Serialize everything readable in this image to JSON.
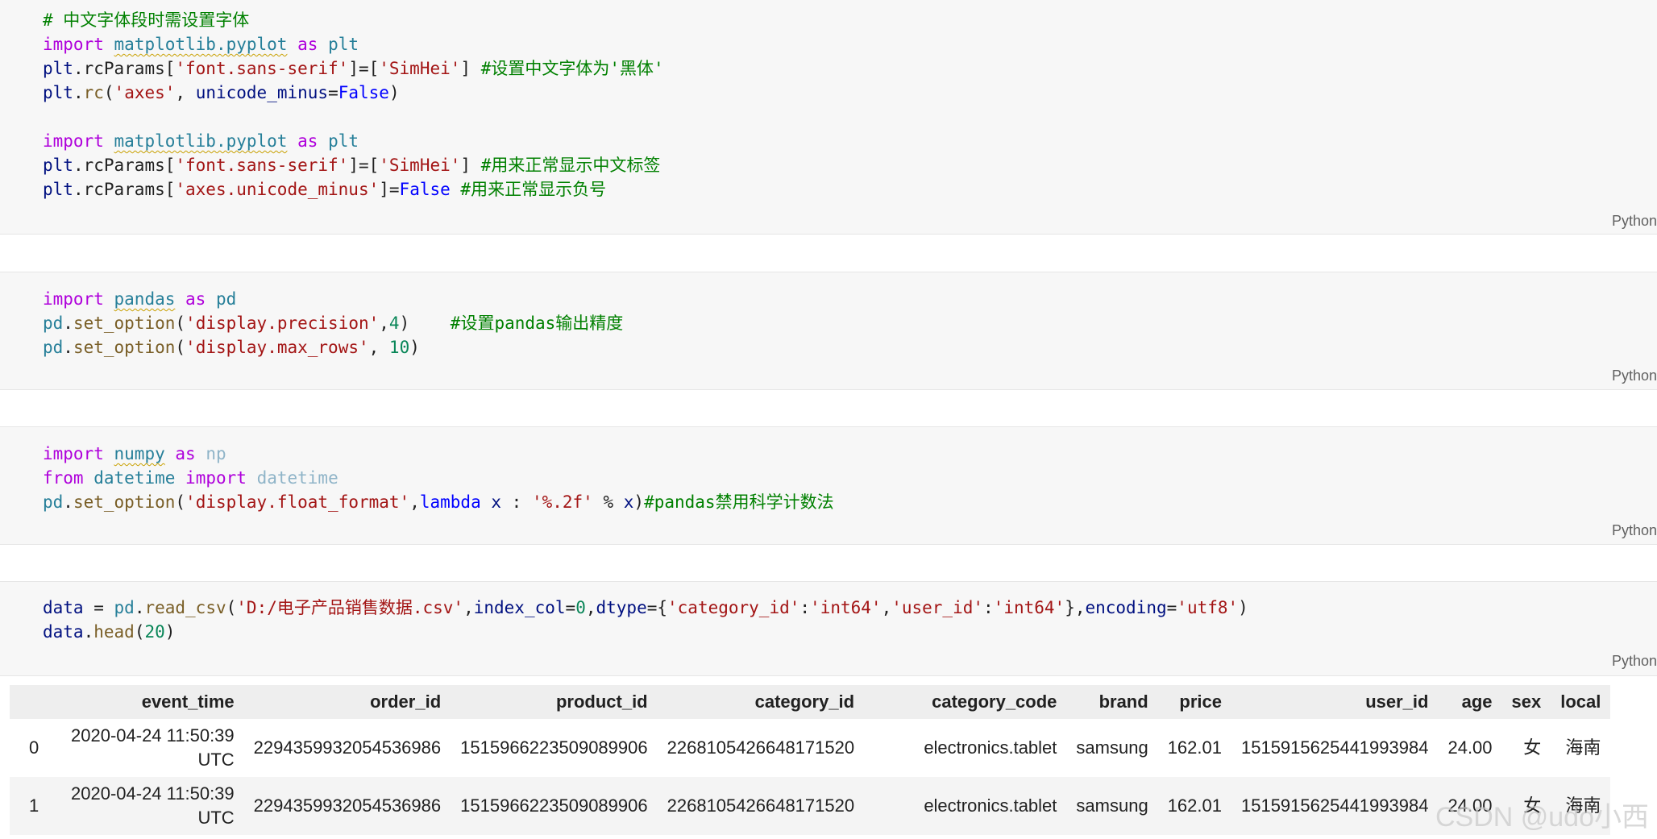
{
  "cells": [
    {
      "language": "Python",
      "code": {
        "l1": "# 中文字体段时需设置字体",
        "l2_kw": "import",
        "l2_mod": "matplotlib.pyplot",
        "l2_as": "as",
        "l2_alias": "plt",
        "l3_a": "plt",
        "l3_b": ".rcParams[",
        "l3_str1": "'font.sans-serif'",
        "l3_c": "]=[",
        "l3_str2": "'SimHei'",
        "l3_d": "] ",
        "l3_cmt": "#设置中文字体为'黑体'",
        "l4_a": "plt",
        "l4_b": ".",
        "l4_fn": "rc",
        "l4_c": "(",
        "l4_str": "'axes'",
        "l4_d": ", ",
        "l4_kwarg": "unicode_minus",
        "l4_e": "=",
        "l4_const": "False",
        "l4_f": ")",
        "l6_kw": "import",
        "l6_mod": "matplotlib.pyplot",
        "l6_as": "as",
        "l6_alias": "plt",
        "l7_a": "plt",
        "l7_b": ".rcParams[",
        "l7_str1": "'font.sans-serif'",
        "l7_c": "]=[",
        "l7_str2": "'SimHei'",
        "l7_d": "] ",
        "l7_cmt": "#用来正常显示中文标签",
        "l8_a": "plt",
        "l8_b": ".rcParams[",
        "l8_str": "'axes.unicode_minus'",
        "l8_c": "]=",
        "l8_const": "False",
        "l8_d": " ",
        "l8_cmt": "#用来正常显示负号"
      }
    },
    {
      "language": "Python",
      "code": {
        "l1_kw": "import",
        "l1_mod": "pandas",
        "l1_as": "as",
        "l1_alias": "pd",
        "l2_a": "pd",
        "l2_b": ".",
        "l2_fn": "set_option",
        "l2_c": "(",
        "l2_str": "'display.precision'",
        "l2_d": ",",
        "l2_num": "4",
        "l2_e": ")    ",
        "l2_cmt": "#设置pandas输出精度",
        "l3_a": "pd",
        "l3_b": ".",
        "l3_fn": "set_option",
        "l3_c": "(",
        "l3_str": "'display.max_rows'",
        "l3_d": ", ",
        "l3_num": "10",
        "l3_e": ")"
      }
    },
    {
      "language": "Python",
      "code": {
        "l1_kw": "import",
        "l1_mod": "numpy",
        "l1_as": "as",
        "l1_alias": "np",
        "l2_from": "from",
        "l2_mod": "datetime",
        "l2_import": "import",
        "l2_name": "datetime",
        "l3_a": "pd",
        "l3_b": ".",
        "l3_fn": "set_option",
        "l3_c": "(",
        "l3_str": "'display.float_format'",
        "l3_d": ",",
        "l3_lambda": "lambda",
        "l3_e": " ",
        "l3_x1": "x",
        "l3_f": " : ",
        "l3_str2": "'%.2f'",
        "l3_g": " % ",
        "l3_x2": "x",
        "l3_h": ")",
        "l3_cmt": "#pandas禁用科学计数法"
      }
    },
    {
      "language": "Python",
      "code": {
        "l1_a": "data",
        "l1_b": " = ",
        "l1_pd": "pd",
        "l1_c": ".",
        "l1_fn": "read_csv",
        "l1_d": "(",
        "l1_str1": "'D:/电子产品销售数据.csv'",
        "l1_e": ",",
        "l1_k1": "index_col",
        "l1_f": "=",
        "l1_num": "0",
        "l1_g": ",",
        "l1_k2": "dtype",
        "l1_h": "={",
        "l1_s2": "'category_id'",
        "l1_i": ":",
        "l1_s3": "'int64'",
        "l1_j": ",",
        "l1_s4": "'user_id'",
        "l1_k": ":",
        "l1_s5": "'int64'",
        "l1_l": "},",
        "l1_k3": "encoding",
        "l1_m": "=",
        "l1_s6": "'utf8'",
        "l1_n": ")",
        "l2_a": "data",
        "l2_b": ".",
        "l2_fn": "head",
        "l2_c": "(",
        "l2_num": "20",
        "l2_d": ")"
      }
    }
  ],
  "table": {
    "columns": [
      "",
      "event_time",
      "order_id",
      "product_id",
      "category_id",
      "category_code",
      "brand",
      "price",
      "user_id",
      "age",
      "sex",
      "local"
    ],
    "rows": [
      {
        "index": "0",
        "event_time_1": "2020-04-24 11:50:39",
        "event_time_2": "UTC",
        "order_id": "2294359932054536986",
        "product_id": "1515966223509089906",
        "category_id": "2268105426648171520",
        "category_code": "electronics.tablet",
        "brand": "samsung",
        "price": "162.01",
        "user_id": "1515915625441993984",
        "age": "24.00",
        "sex": "女",
        "local": "海南"
      },
      {
        "index": "1",
        "event_time_1": "2020-04-24 11:50:39",
        "event_time_2": "UTC",
        "order_id": "2294359932054536986",
        "product_id": "1515966223509089906",
        "category_id": "2268105426648171520",
        "category_code": "electronics.tablet",
        "brand": "samsung",
        "price": "162.01",
        "user_id": "1515915625441993984",
        "age": "24.00",
        "sex": "女",
        "local": "海南"
      }
    ]
  },
  "watermark": "CSDN @udo小西"
}
